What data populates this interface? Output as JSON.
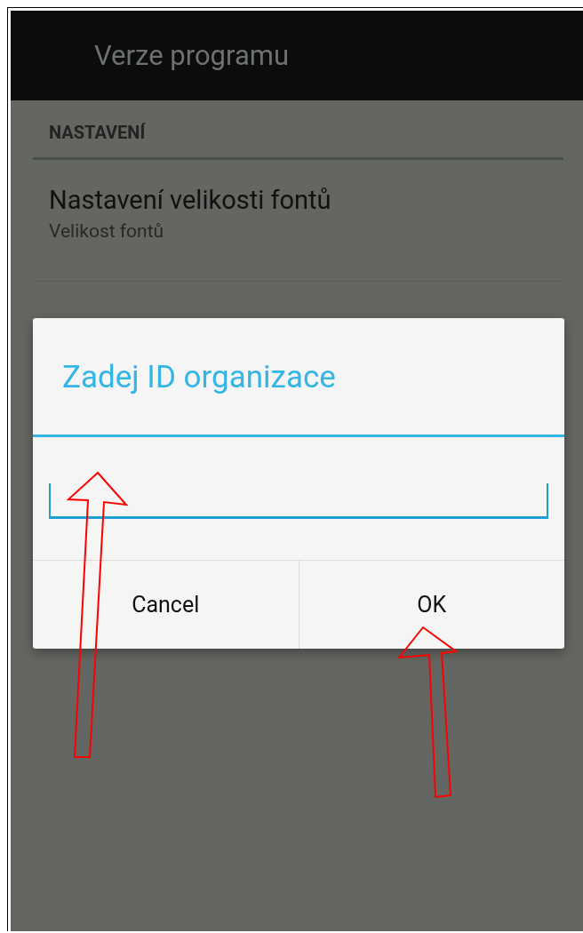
{
  "action_bar": {
    "title": "Verze programu"
  },
  "settings": {
    "header": "NASTAVENÍ",
    "items": [
      {
        "title": "Nastavení velikosti fontů",
        "summary": "Velikost fontů"
      }
    ]
  },
  "dialog": {
    "title": "Zadej ID organizace",
    "buttons": [
      {
        "label": "Cancel"
      },
      {
        "label": "OK"
      }
    ]
  }
}
